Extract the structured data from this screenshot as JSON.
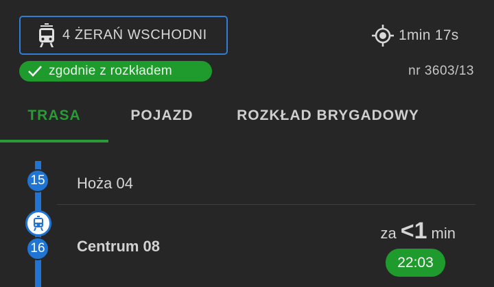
{
  "header": {
    "line_label": "4 ŻERAŃ WSCHODNI",
    "gps_age": "1min 17s",
    "status": "zgodnie z rozkładem",
    "vehicle_number": "nr 3603/13"
  },
  "tabs": [
    {
      "label": "TRASA",
      "active": true
    },
    {
      "label": "POJAZD",
      "active": false
    },
    {
      "label": "ROZKŁAD BRYGADOWY",
      "active": false
    }
  ],
  "stops": [
    {
      "number": "15",
      "name": "Hoża 04"
    },
    {
      "number": "16",
      "name": "Centrum 08",
      "eta_prefix": "za",
      "eta_value": "<1",
      "eta_unit": "min",
      "time": "22:03"
    }
  ],
  "colors": {
    "accent_green": "#1e9b2c",
    "route_blue": "#1f74d4",
    "background": "#262626"
  },
  "icons": [
    "tram-icon",
    "gps-location-icon",
    "checkmark-icon",
    "vehicle-position-icon"
  ]
}
